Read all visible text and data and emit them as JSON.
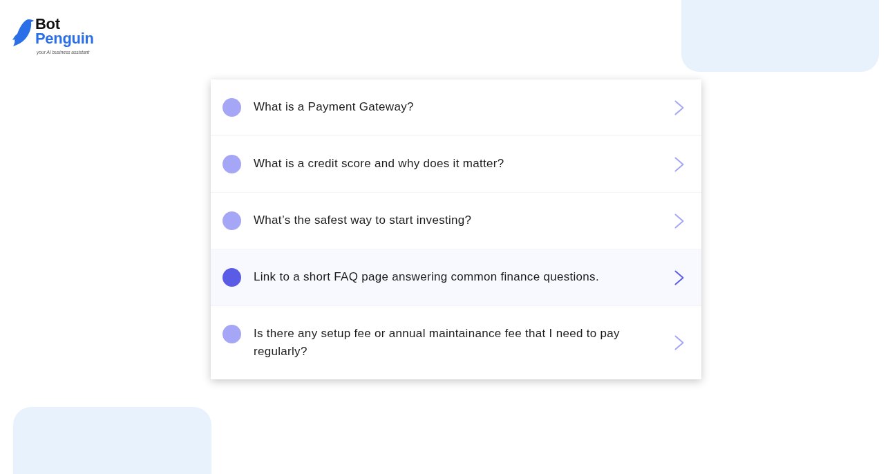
{
  "logo": {
    "brand_first": "Bot",
    "brand_second": "Penguin",
    "tagline": "your AI business assistant"
  },
  "questions": [
    {
      "text": "What is a Payment Gateway?",
      "selected": false
    },
    {
      "text": "What is a credit score and why does it matter?",
      "selected": false
    },
    {
      "text": "What’s the safest way to start investing?",
      "selected": false
    },
    {
      "text": "Link to a short FAQ page answering common finance questions.",
      "selected": true
    },
    {
      "text": "Is there any setup fee or annual maintainance fee that I need to pay regularly?",
      "selected": false
    }
  ]
}
